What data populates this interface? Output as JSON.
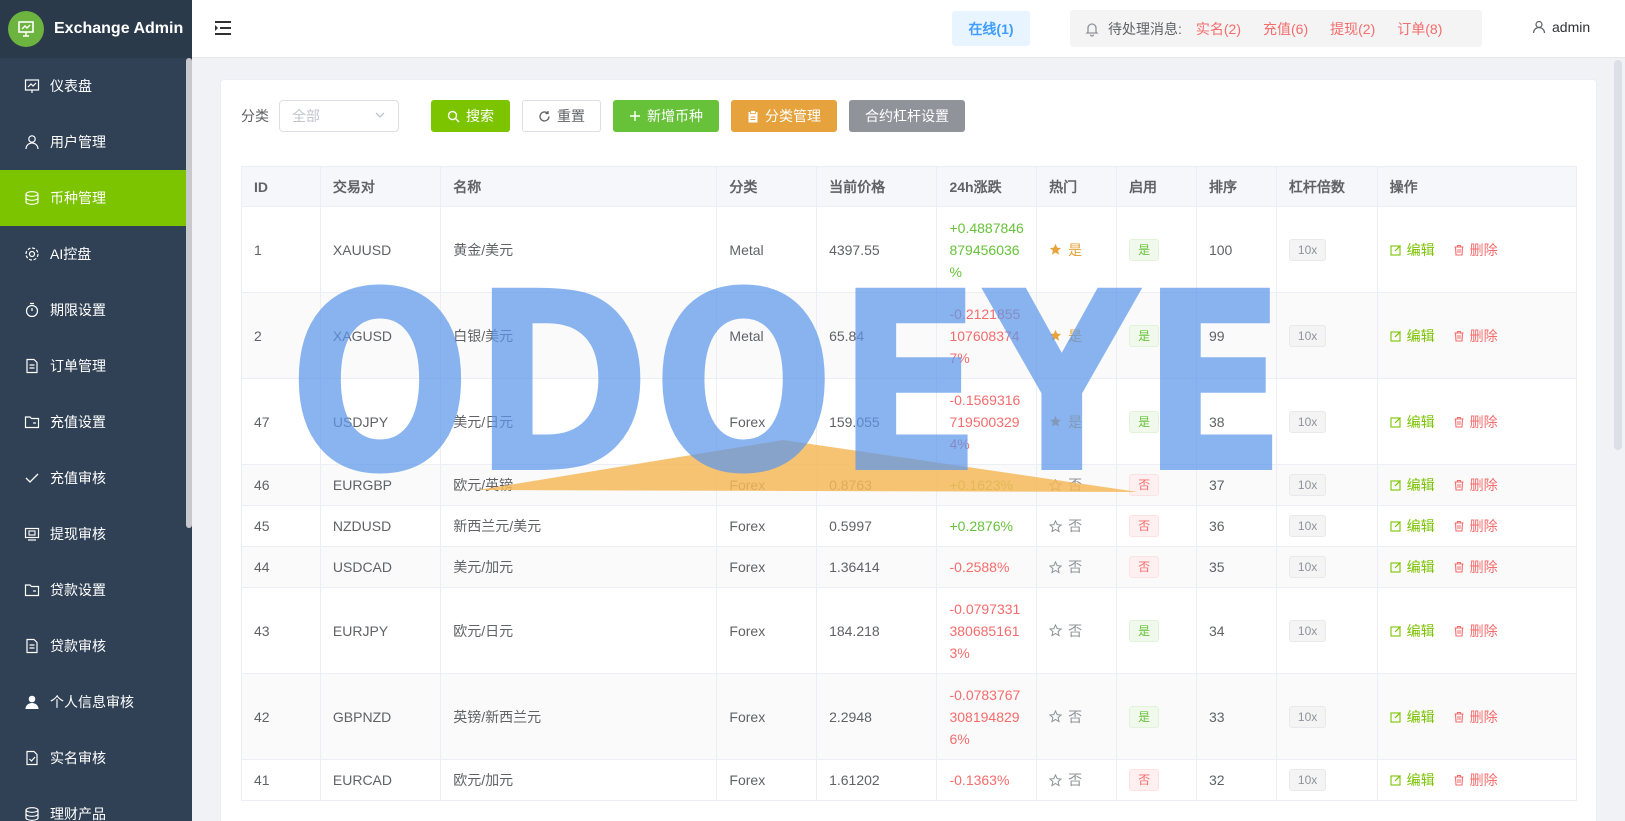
{
  "app": {
    "title": "Exchange Admin"
  },
  "sidebar": {
    "items": [
      {
        "label": "仪表盘",
        "icon": "dashboard-icon"
      },
      {
        "label": "用户管理",
        "icon": "user-icon"
      },
      {
        "label": "币种管理",
        "icon": "coin-icon",
        "active": true
      },
      {
        "label": "AI控盘",
        "icon": "gear-icon"
      },
      {
        "label": "期限设置",
        "icon": "timer-icon"
      },
      {
        "label": "订单管理",
        "icon": "document-icon"
      },
      {
        "label": "充值设置",
        "icon": "folder-icon"
      },
      {
        "label": "充值审核",
        "icon": "check-icon"
      },
      {
        "label": "提现审核",
        "icon": "photo-icon"
      },
      {
        "label": "贷款设置",
        "icon": "folder-icon"
      },
      {
        "label": "贷款审核",
        "icon": "document-icon"
      },
      {
        "label": "个人信息审核",
        "icon": "avatar-icon"
      },
      {
        "label": "实名审核",
        "icon": "doc-check-icon"
      },
      {
        "label": "理财产品",
        "icon": "coin-icon"
      }
    ]
  },
  "header": {
    "online": "在线(1)",
    "pending_label": "待处理消息:",
    "pending_links": [
      "实名(2)",
      "充值(6)",
      "提现(2)",
      "订单(8)"
    ],
    "user": "admin"
  },
  "filter": {
    "label": "分类",
    "select_value": "全部",
    "buttons": {
      "search": "搜索",
      "reset": "重置",
      "add": "新增币种",
      "category": "分类管理",
      "leverage": "合约杠杆设置"
    }
  },
  "table": {
    "headers": [
      "ID",
      "交易对",
      "名称",
      "分类",
      "当前价格",
      "24h涨跌",
      "热门",
      "启用",
      "排序",
      "杠杆倍数",
      "操作"
    ],
    "edit_label": "编辑",
    "delete_label": "删除",
    "rows": [
      {
        "id": "1",
        "pair": "XAUUSD",
        "name": "黄金/美元",
        "cat": "Metal",
        "price": "4397.55",
        "change": [
          "+0.4887846",
          "879456036",
          "%"
        ],
        "dir": "pos",
        "hot": "是",
        "enabled": "是",
        "sort": "100",
        "lev": "10x"
      },
      {
        "id": "2",
        "pair": "XAGUSD",
        "name": "白银/美元",
        "cat": "Metal",
        "price": "65.84",
        "change": [
          "-0.2121855",
          "107608374",
          "7%"
        ],
        "dir": "neg",
        "hot": "是",
        "enabled": "是",
        "sort": "99",
        "lev": "10x"
      },
      {
        "id": "47",
        "pair": "USDJPY",
        "name": "美元/日元",
        "cat": "Forex",
        "price": "159.055",
        "change": [
          "-0.1569316",
          "719500329",
          "4%"
        ],
        "dir": "neg",
        "hot": "是",
        "enabled": "是",
        "sort": "38",
        "lev": "10x"
      },
      {
        "id": "46",
        "pair": "EURGBP",
        "name": "欧元/英镑",
        "cat": "Forex",
        "price": "0.8763",
        "change": [
          "+0.1623%"
        ],
        "dir": "pos",
        "hot": "否",
        "enabled": "否",
        "sort": "37",
        "lev": "10x"
      },
      {
        "id": "45",
        "pair": "NZDUSD",
        "name": "新西兰元/美元",
        "cat": "Forex",
        "price": "0.5997",
        "change": [
          "+0.2876%"
        ],
        "dir": "pos",
        "hot": "否",
        "enabled": "否",
        "sort": "36",
        "lev": "10x"
      },
      {
        "id": "44",
        "pair": "USDCAD",
        "name": "美元/加元",
        "cat": "Forex",
        "price": "1.36414",
        "change": [
          "-0.2588%"
        ],
        "dir": "neg",
        "hot": "否",
        "enabled": "否",
        "sort": "35",
        "lev": "10x"
      },
      {
        "id": "43",
        "pair": "EURJPY",
        "name": "欧元/日元",
        "cat": "Forex",
        "price": "184.218",
        "change": [
          "-0.0797331",
          "380685161",
          "3%"
        ],
        "dir": "neg",
        "hot": "否",
        "enabled": "是",
        "sort": "34",
        "lev": "10x"
      },
      {
        "id": "42",
        "pair": "GBPNZD",
        "name": "英镑/新西兰元",
        "cat": "Forex",
        "price": "2.2948",
        "change": [
          "-0.0783767",
          "308194829",
          "6%"
        ],
        "dir": "neg",
        "hot": "否",
        "enabled": "是",
        "sort": "33",
        "lev": "10x"
      },
      {
        "id": "41",
        "pair": "EURCAD",
        "name": "欧元/加元",
        "cat": "Forex",
        "price": "1.61202",
        "change": [
          "-0.1363%"
        ],
        "dir": "neg",
        "hot": "否",
        "enabled": "否",
        "sort": "32",
        "lev": "10x"
      }
    ]
  },
  "watermark": {
    "text": "ODOEYE"
  },
  "colors": {
    "accent": "#7cc300",
    "sidebar": "#304156",
    "danger": "#f56c6c",
    "success": "#67c23a",
    "warning": "#e6a23c"
  }
}
